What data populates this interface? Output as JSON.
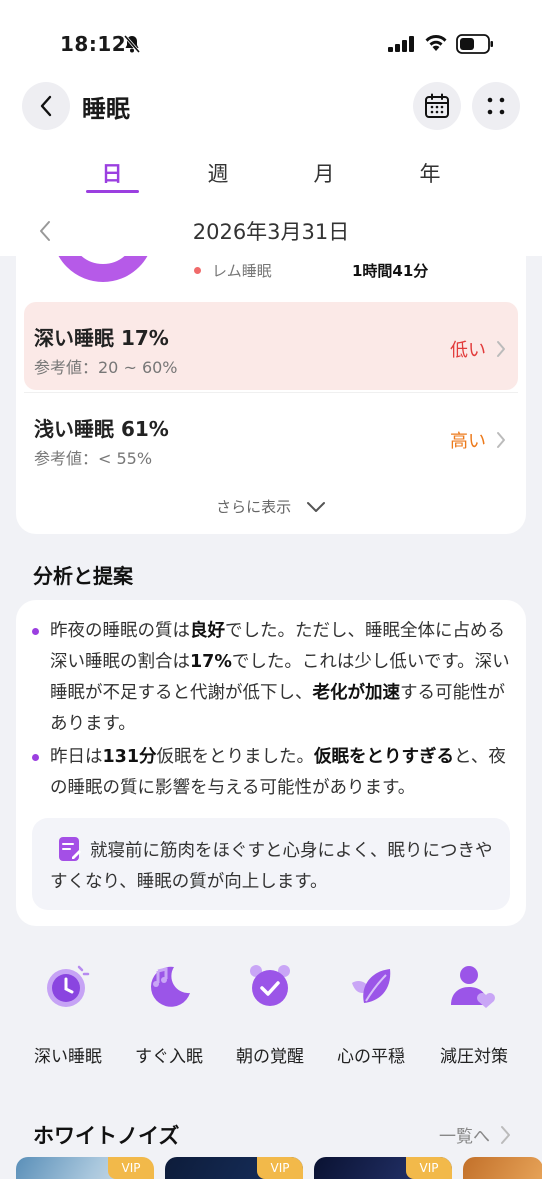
{
  "status_bar": {
    "time": "18:12"
  },
  "header": {
    "title": "睡眠"
  },
  "tabs": [
    {
      "label": "日",
      "active": true
    },
    {
      "label": "週",
      "active": false
    },
    {
      "label": "月",
      "active": false
    },
    {
      "label": "年",
      "active": false
    }
  ],
  "date": "2026年3月31日",
  "rem": {
    "label": "レム睡眠",
    "value": "1時間41分",
    "color": "#f06a6a"
  },
  "stages": [
    {
      "name": "深い睡眠 17%",
      "reference": "参考値：20 ~ 60%",
      "flag": "低い"
    },
    {
      "name": "浅い睡眠 61%",
      "reference": "参考値：< 55%",
      "flag": "高い"
    }
  ],
  "show_more": "さらに表示",
  "analysis": {
    "title": "分析と提案",
    "bullet1": {
      "p1": "昨夜の睡眠の質は",
      "b1": "良好",
      "p2": "でした。ただし、睡眠全体に占める深い睡眠の割合は",
      "b2": "17%",
      "p3": "でした。これは少し低いです。深い睡眠が不足すると代謝が低下し、",
      "b3": "老化が加速",
      "p4": "する可能性があります。"
    },
    "bullet2": {
      "p1": "昨日は",
      "b1": "131分",
      "p2": "仮眠をとりました。",
      "b2": "仮眠をとりすぎる",
      "p3": "と、夜の睡眠の質に影響を与える可能性があります。"
    },
    "tip": "就寝前に筋肉をほぐすと心身によく、眠りにつきやすくなり、睡眠の質が向上します。"
  },
  "shortcuts": [
    {
      "label": "深い睡眠",
      "icon": "clock-icon"
    },
    {
      "label": "すぐ入眠",
      "icon": "moon-music-icon"
    },
    {
      "label": "朝の覚醒",
      "icon": "alarm-icon"
    },
    {
      "label": "心の平穏",
      "icon": "leaf-icon"
    },
    {
      "label": "減圧対策",
      "icon": "person-heart-icon"
    }
  ],
  "white_noise": {
    "title": "ホワイトノイズ",
    "link": "一覧へ",
    "badges": [
      "VIP",
      "VIP",
      "VIP"
    ]
  },
  "colors": {
    "accent": "#9b3fe0",
    "low": "#e23b3b",
    "high": "#ec7a1c",
    "vip": "#f2b94a"
  }
}
